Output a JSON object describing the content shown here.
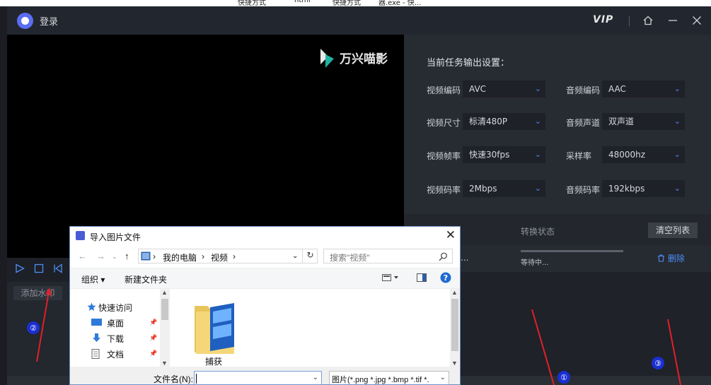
{
  "top_strip": [
    "快捷方式",
    "html",
    "快捷方式",
    "器.exe - 快..."
  ],
  "titlebar": {
    "login": "登录",
    "vip": "VIP"
  },
  "preview": {
    "brand": "万兴喵影"
  },
  "left_controls": {
    "watermark_button": "添加水印"
  },
  "settings": {
    "title": "当前任务输出设置：",
    "rows": [
      {
        "label1": "视频编码",
        "value1": "AVC",
        "label2": "音频编码",
        "value2": "AAC"
      },
      {
        "label1": "视频尺寸",
        "value1": "标清480P",
        "label2": "音频声道",
        "value2": "双声道"
      },
      {
        "label1": "视频帧率",
        "value1": "快速30fps",
        "label2": "采样率",
        "value2": "48000hz"
      },
      {
        "label1": "视频码率",
        "value1": "2Mbps",
        "label2": "音频码率",
        "value2": "192kbps"
      }
    ]
  },
  "tasks": {
    "status_header": "转换状态",
    "clear_button": "清空列表",
    "row": {
      "name_tail": "...",
      "status": "等待中...",
      "progress": 0,
      "delete": "删除"
    }
  },
  "annotations": [
    "①",
    "②",
    "③"
  ],
  "colors": {
    "accent": "#4d8ef5",
    "annotation_red": "#e0202a",
    "annotation_circle": "#1a2fd0"
  },
  "dialog": {
    "title": "导入图片文件",
    "address": [
      "我的电脑",
      "视频"
    ],
    "search_placeholder": "搜索\"视频\"",
    "toolbar": {
      "organize": "组织 ▾",
      "new_folder": "新建文件夹"
    },
    "sidebar": [
      {
        "label": "快速访问",
        "icon": "star-icon"
      },
      {
        "label": "桌面",
        "icon": "desktop-icon"
      },
      {
        "label": "下载",
        "icon": "download-icon"
      },
      {
        "label": "文档",
        "icon": "document-icon"
      }
    ],
    "folder": {
      "label": "捕获"
    },
    "filename_label": "文件名(N):",
    "filename_value": "",
    "filetype": "图片(*.png *.jpg *.bmp *.tif *."
  }
}
